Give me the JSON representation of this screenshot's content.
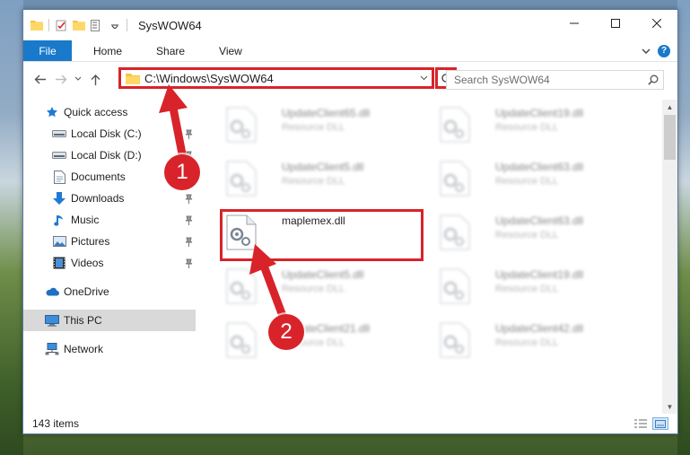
{
  "window": {
    "title": "SysWOW64",
    "controls": {
      "minimize": "—",
      "maximize": "☐",
      "close": "✕"
    }
  },
  "ribbon": {
    "tabs": [
      "File",
      "Home",
      "Share",
      "View"
    ]
  },
  "address": {
    "path": "C:\\Windows\\SysWOW64"
  },
  "search": {
    "placeholder": "Search SysWOW64"
  },
  "nav": {
    "items": [
      {
        "label": "Quick access",
        "icon": "star-icon"
      },
      {
        "label": "Local Disk (C:)",
        "icon": "drive-icon",
        "pinned": true
      },
      {
        "label": "Local Disk (D:)",
        "icon": "drive-icon",
        "pinned": true
      },
      {
        "label": "Documents",
        "icon": "documents-icon",
        "pinned": true
      },
      {
        "label": "Downloads",
        "icon": "download-icon",
        "pinned": true
      },
      {
        "label": "Music",
        "icon": "music-icon",
        "pinned": true
      },
      {
        "label": "Pictures",
        "icon": "pictures-icon",
        "pinned": true
      },
      {
        "label": "Videos",
        "icon": "videos-icon",
        "pinned": true
      },
      {
        "label": "OneDrive",
        "icon": "cloud-icon"
      },
      {
        "label": "This PC",
        "icon": "computer-icon",
        "selected": true
      },
      {
        "label": "Network",
        "icon": "network-icon"
      }
    ]
  },
  "files": [
    {
      "name": "UpdateClient65.dll",
      "desc": "Resource DLL",
      "blurred": true
    },
    {
      "name": "UpdateClient19.dll",
      "desc": "Resource DLL",
      "blurred": true
    },
    {
      "name": "UpdateClient5.dll",
      "desc": "Resource DLL",
      "blurred": true
    },
    {
      "name": "UpdateClient63.dll",
      "desc": "Resource DLL",
      "blurred": true
    },
    {
      "name": "maplemex.dll",
      "desc": "",
      "blurred": false
    },
    {
      "name": "UpdateClient63.dll",
      "desc": "Resource DLL",
      "blurred": true
    },
    {
      "name": "UpdateClient5.dll",
      "desc": "Resource DLL",
      "blurred": true
    },
    {
      "name": "UpdateClient19.dll",
      "desc": "Resource DLL",
      "blurred": true
    },
    {
      "name": "UpdateClient21.dll",
      "desc": "Resource DLL",
      "blurred": true
    },
    {
      "name": "UpdateClient42.dll",
      "desc": "Resource DLL",
      "blurred": true
    }
  ],
  "status": {
    "item_count": "143 items"
  },
  "annotations": {
    "step1": "1",
    "step2": "2",
    "accent_color": "#d8232a"
  }
}
